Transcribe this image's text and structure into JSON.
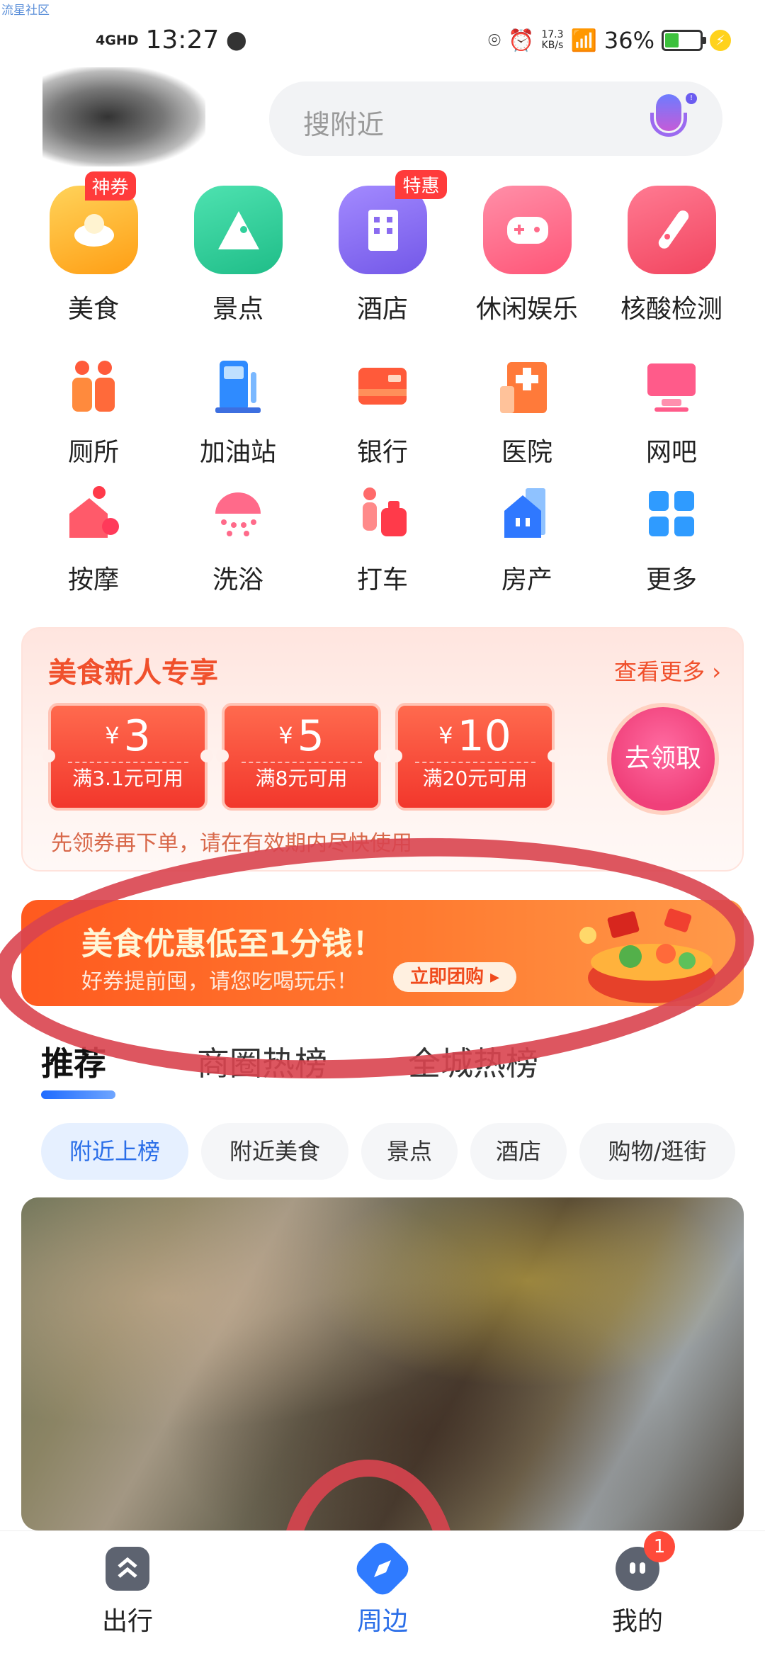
{
  "watermark": "流星社区",
  "status_bar": {
    "network": "4GHD",
    "time": "13:27",
    "speed_value": "17.3",
    "speed_unit": "KB/s",
    "battery_percent": "36%"
  },
  "search": {
    "placeholder": "搜附近"
  },
  "categories_row1": [
    {
      "label": "美食",
      "badge": "神券",
      "icon": "food-icon",
      "color": "#ffb21c"
    },
    {
      "label": "景点",
      "badge": "",
      "icon": "scenic-icon",
      "color": "#2fcf9a"
    },
    {
      "label": "酒店",
      "badge": "特惠",
      "icon": "hotel-icon",
      "color": "#8a6bf0"
    },
    {
      "label": "休闲娱乐",
      "badge": "",
      "icon": "gamepad-icon",
      "color": "#ff6b8a"
    },
    {
      "label": "核酸检测",
      "badge": "",
      "icon": "test-tube-icon",
      "color": "#ff5b78"
    }
  ],
  "categories_row2": [
    {
      "label": "厕所",
      "icon": "toilet-icon"
    },
    {
      "label": "加油站",
      "icon": "gas-station-icon"
    },
    {
      "label": "银行",
      "icon": "bank-card-icon"
    },
    {
      "label": "医院",
      "icon": "hospital-icon"
    },
    {
      "label": "网吧",
      "icon": "monitor-icon"
    }
  ],
  "categories_row3": [
    {
      "label": "按摩",
      "icon": "massage-icon"
    },
    {
      "label": "洗浴",
      "icon": "shower-icon"
    },
    {
      "label": "打车",
      "icon": "taxi-icon"
    },
    {
      "label": "房产",
      "icon": "house-icon"
    },
    {
      "label": "更多",
      "icon": "grid-icon"
    }
  ],
  "coupon_card": {
    "title": "美食新人专享",
    "more": "查看更多",
    "coupons": [
      {
        "currency": "¥",
        "amount": "3",
        "condition": "满3.1元可用"
      },
      {
        "currency": "¥",
        "amount": "5",
        "condition": "满8元可用"
      },
      {
        "currency": "¥",
        "amount": "10",
        "condition": "满20元可用"
      }
    ],
    "claim_button": "去领取",
    "tip": "先领券再下单，请在有效期内尽快使用"
  },
  "banner": {
    "title": "美食优惠低至1分钱！",
    "subtitle": "好券提前囤，请您吃喝玩乐！",
    "button": "立即团购 ▸"
  },
  "tabs": [
    "推荐",
    "商圈热榜",
    "全城热榜"
  ],
  "chips": [
    "附近上榜",
    "附近美食",
    "景点",
    "酒店",
    "购物/逛街"
  ],
  "bottom_nav": [
    {
      "label": "出行",
      "icon": "travel-icon",
      "active": false,
      "badge": ""
    },
    {
      "label": "周边",
      "icon": "compass-icon",
      "active": true,
      "badge": ""
    },
    {
      "label": "我的",
      "icon": "profile-icon",
      "active": false,
      "badge": "1"
    }
  ],
  "colors": {
    "accent_blue": "#2a6ee8",
    "promo_red": "#f0502c",
    "annotation_red": "#d9444f"
  }
}
